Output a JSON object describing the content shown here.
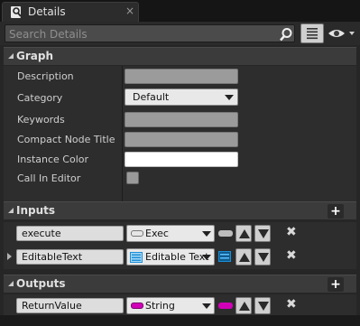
{
  "tab": {
    "title": "Details",
    "icon": "magnifier-doc-icon",
    "close": "×"
  },
  "search": {
    "placeholder": "Search Details"
  },
  "graph": {
    "header": "Graph",
    "properties": [
      {
        "label": "Description",
        "type": "text",
        "value": ""
      },
      {
        "label": "Category",
        "type": "combo",
        "value": "Default"
      },
      {
        "label": "Keywords",
        "type": "text",
        "value": ""
      },
      {
        "label": "Compact Node Title",
        "type": "text",
        "value": ""
      },
      {
        "label": "Instance Color",
        "type": "color",
        "value": "#FFFFFF"
      },
      {
        "label": "Call In Editor",
        "type": "checkbox",
        "value": false
      }
    ]
  },
  "inputs": {
    "header": "Inputs",
    "add": "+",
    "pins": [
      {
        "name": "execute",
        "type": "Exec",
        "color": "#e6e6e6"
      },
      {
        "name": "EditableText",
        "type": "Editable Text",
        "color": "#1c8fd6"
      }
    ]
  },
  "outputs": {
    "header": "Outputs",
    "add": "+",
    "pins": [
      {
        "name": "ReturnValue",
        "type": "String",
        "color": "#d100b8"
      }
    ]
  },
  "delete_glyph": "✖"
}
